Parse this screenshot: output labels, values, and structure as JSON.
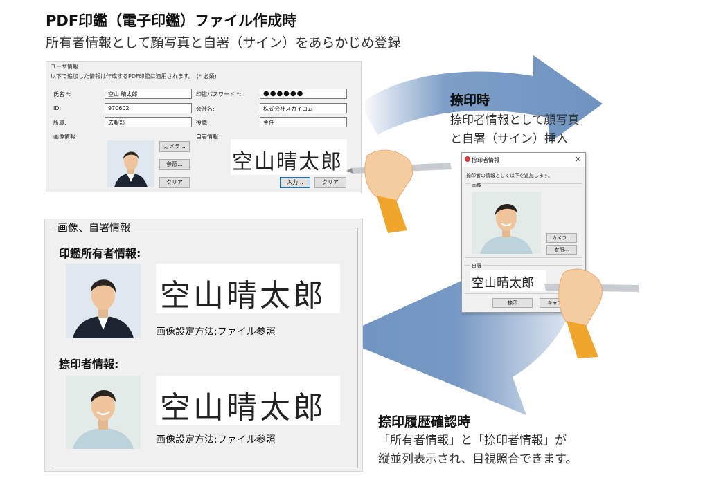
{
  "header": {
    "title": "PDF印鑑（電子印鑑）ファイル作成時",
    "subtitle": "所有者情報として顔写真と自署（サイン）をあらかじめ登録"
  },
  "user_info_panel": {
    "heading": "ユーザ情報",
    "description": "以下で追加した情報は作成するPDF印鑑に適用されます。　(* 必須)",
    "name_label": "氏名 *:",
    "name_value": "空山 晴太郎",
    "password_label": "印鑑パスワード *:",
    "password_value": "●●●●●●",
    "id_label": "ID:",
    "id_value": "970602",
    "company_label": "会社名:",
    "company_value": "株式会社スカイコム",
    "dept_label": "所属:",
    "dept_value": "広報部",
    "position_label": "役職:",
    "position_value": "主任",
    "image_info_label": "画像情報:",
    "signature_info_label": "自署情報:",
    "camera_button": "カメラ...",
    "browse_button": "参照...",
    "clear_button": "クリア",
    "input_button": "入力...",
    "clear_button_2": "クリア",
    "signature_text": "空山晴太郎"
  },
  "image_signature_panel": {
    "title": "画像、自署情報",
    "owner_section": "印鑑所有者情報:",
    "owner_setting": "画像設定方法:ファイル参照",
    "stamper_section": "捺印者情報:",
    "stamper_setting": "画像設定方法:ファイル参照",
    "signature_text": "空山晴太郎"
  },
  "stamp_time": {
    "title": "捺印時",
    "line1": "捺印者情報として顔写真",
    "line2": "と自署（サイン）挿入"
  },
  "dialog": {
    "title": "捺印者情報",
    "close": "✕",
    "description": "捺印者の情報として以下を追加します。",
    "image_label": "画像",
    "camera_button": "カメラ...",
    "browse_button": "参照...",
    "signature_label": "自署",
    "signature_text": "空山晴太郎",
    "stamp_button": "捺印",
    "cancel_button": "キャンセル"
  },
  "history": {
    "title": "捺印履歴確認時",
    "line1": "「所有者情報」と「捺印者情報」が",
    "line2": "縦並列表示され、目視照合できます。"
  },
  "colors": {
    "arrow": "#6f93c0",
    "sleeve": "#f0a52c",
    "skin": "#f5cca0",
    "panel_bg": "#f0f0f0",
    "accent": "#0078d7"
  }
}
